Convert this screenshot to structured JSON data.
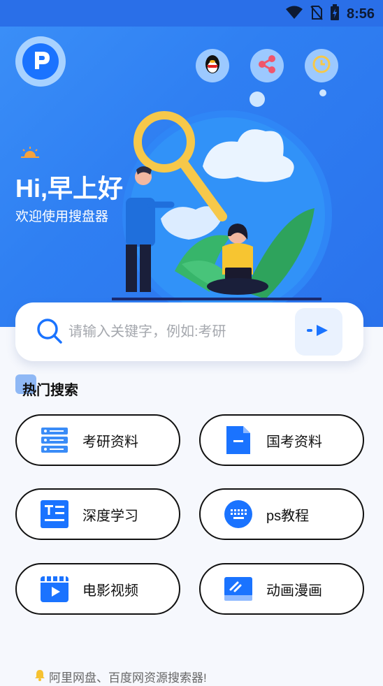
{
  "status_bar": {
    "time": "8:56"
  },
  "header": {
    "greeting": "Hi,早上好",
    "welcome": "欢迎使用搜盘器"
  },
  "search": {
    "placeholder": "请输入关键字，例如:考研"
  },
  "hot_search": {
    "title": "热门搜索",
    "items": [
      {
        "label": "考研资料",
        "icon": "server-list-icon"
      },
      {
        "label": "国考资料",
        "icon": "document-icon"
      },
      {
        "label": "深度学习",
        "icon": "text-doc-icon"
      },
      {
        "label": "ps教程",
        "icon": "keyboard-icon"
      },
      {
        "label": "电影视频",
        "icon": "video-play-icon"
      },
      {
        "label": "动画漫画",
        "icon": "drawing-tablet-icon"
      }
    ]
  },
  "footer": {
    "text": "阿里网盘、百度网资源搜索器!"
  },
  "colors": {
    "primary": "#2f7ff2",
    "accent": "#1a73ff"
  }
}
